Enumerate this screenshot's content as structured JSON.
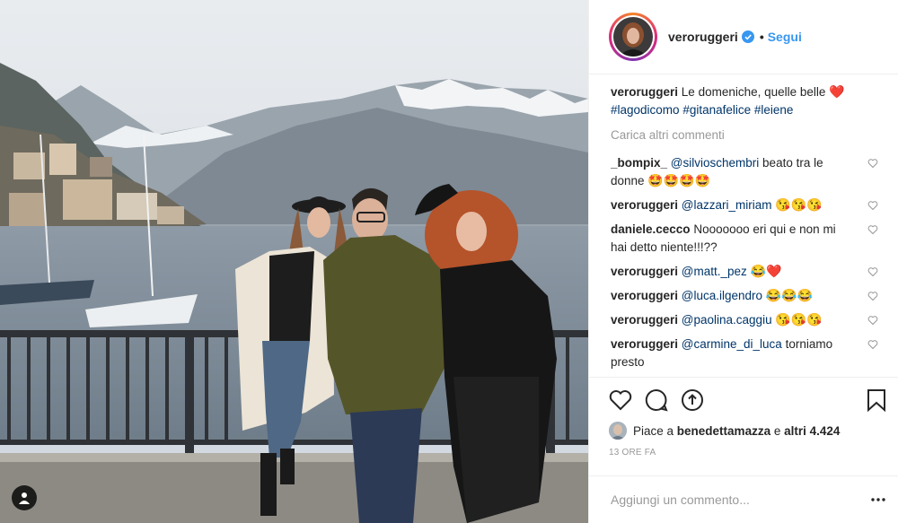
{
  "header": {
    "username": "veroruggeri",
    "separator": "•",
    "follow_label": "Segui"
  },
  "caption": {
    "username": "veroruggeri",
    "text": "Le domeniche, quelle belle",
    "emoji": "❤️",
    "hashtags": [
      "#lagodicomo",
      "#gitanafelice",
      "#leiene"
    ]
  },
  "load_more": "Carica altri commenti",
  "comments": [
    {
      "user": "_bompix_",
      "mention": "@silvioschembri",
      "text": "beato tra le donne",
      "emoji": "🤩🤩🤩🤩"
    },
    {
      "user": "veroruggeri",
      "mention": "@lazzari_miriam",
      "text": "",
      "emoji": "😘😘😘"
    },
    {
      "user": "daniele.cecco",
      "mention": "",
      "text": "Nooooooo eri qui e non mi hai detto niente!!!??",
      "emoji": ""
    },
    {
      "user": "veroruggeri",
      "mention": "@matt._pez",
      "text": "",
      "emoji": "😂❤️"
    },
    {
      "user": "veroruggeri",
      "mention": "@luca.ilgendro",
      "text": "",
      "emoji": "😂😂😂"
    },
    {
      "user": "veroruggeri",
      "mention": "@paolina.caggiu",
      "text": "",
      "emoji": "😘😘😘"
    },
    {
      "user": "veroruggeri",
      "mention": "@carmine_di_luca",
      "text": "torniamo presto",
      "emoji": ""
    }
  ],
  "likes": {
    "prefix": "Piace a",
    "user": "benedettamazza",
    "middle": "e",
    "others": "altri 4.424"
  },
  "timestamp": "13 ORE FA",
  "add_comment": {
    "placeholder": "Aggiungi un commento..."
  },
  "icons": {
    "like": "heart-icon",
    "comment": "comment-icon",
    "share": "share-icon",
    "save": "bookmark-icon",
    "options": "more-options-icon",
    "verified": "verified-badge-icon",
    "tag": "user-tag-icon"
  },
  "colors": {
    "link": "#3897f0",
    "hashtag": "#003569",
    "muted": "#999999",
    "text": "#262626",
    "verified": "#3897f0"
  }
}
